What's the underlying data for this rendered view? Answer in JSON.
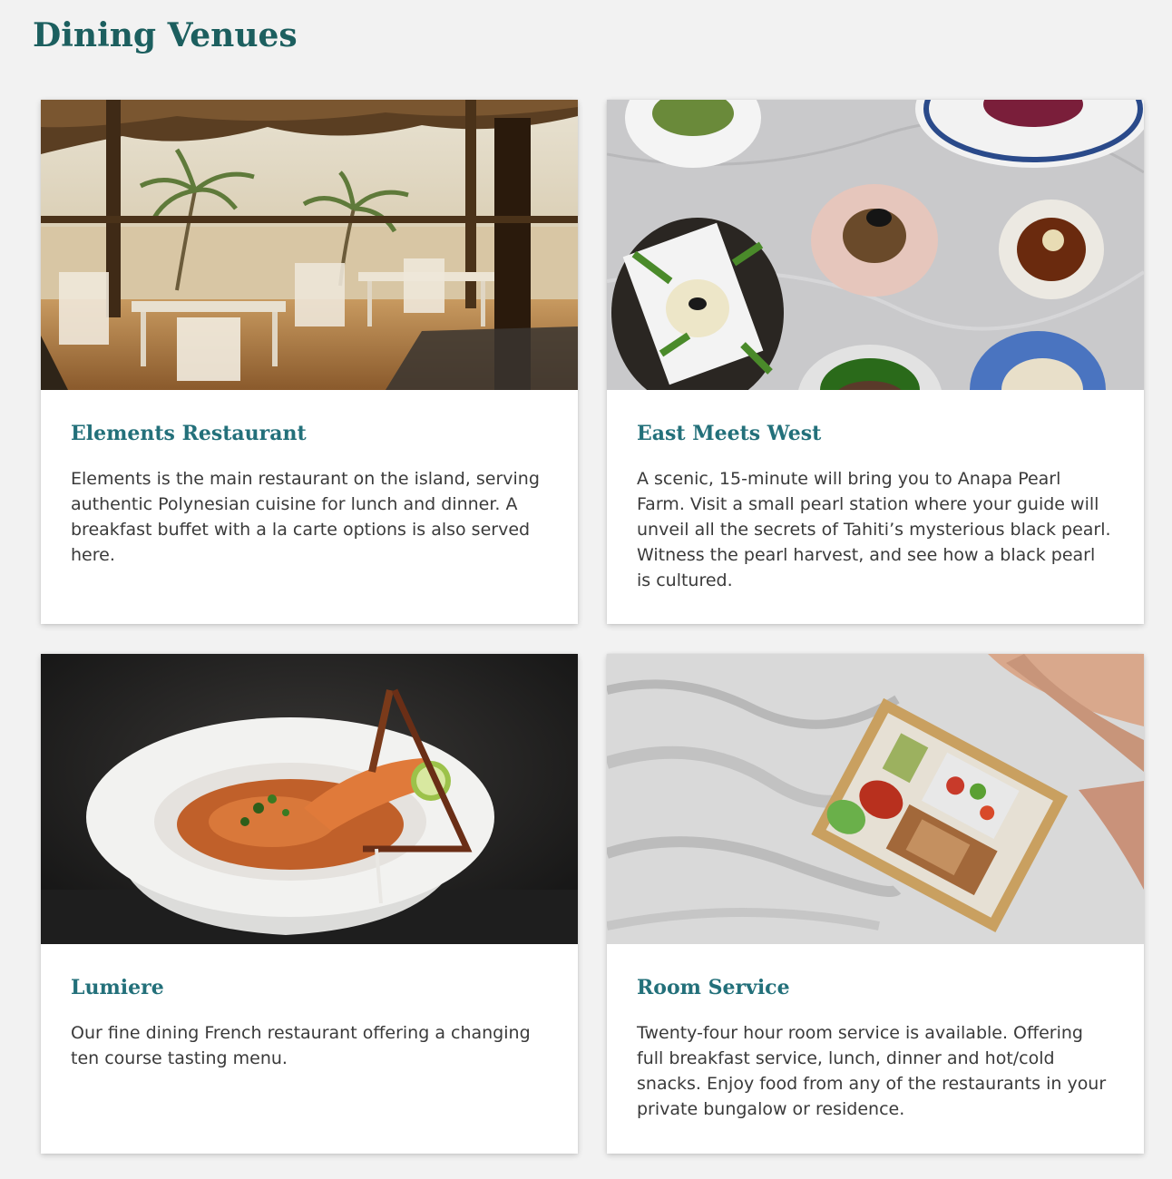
{
  "page": {
    "title": "Dining Venues"
  },
  "colors": {
    "title": "#1c5f5f",
    "card_title": "#23707a",
    "text": "#3a3a3a",
    "background": "#f2f2f2",
    "card": "#ffffff"
  },
  "venues": [
    {
      "name": "Elements Restaurant",
      "description": "Elements is the main restaurant on the island, serving authentic Polynesian cuisine for lunch and dinner. A breakfast buffet with a la carte options is also served here.",
      "image": "beach-restaurant-photo"
    },
    {
      "name": "East Meets West",
      "description": "A scenic, 15-minute will bring you to Anapa Pearl Farm. Visit a small pearl station where your guide will unveil all the secrets of Tahiti’s mysterious black pearl. Witness the pearl harvest, and see how a black pearl is cultured.",
      "image": "plated-dishes-photo"
    },
    {
      "name": "Lumiere",
      "description": "Our fine dining French restaurant offering a changing ten course tasting menu.",
      "image": "shrimp-soup-photo"
    },
    {
      "name": "Room Service",
      "description": "Twenty-four hour room service is available. Offering full breakfast service, lunch, dinner and hot/cold snacks. Enjoy food from any of the restaurants in your private bungalow or residence.",
      "image": "breakfast-tray-photo"
    }
  ]
}
